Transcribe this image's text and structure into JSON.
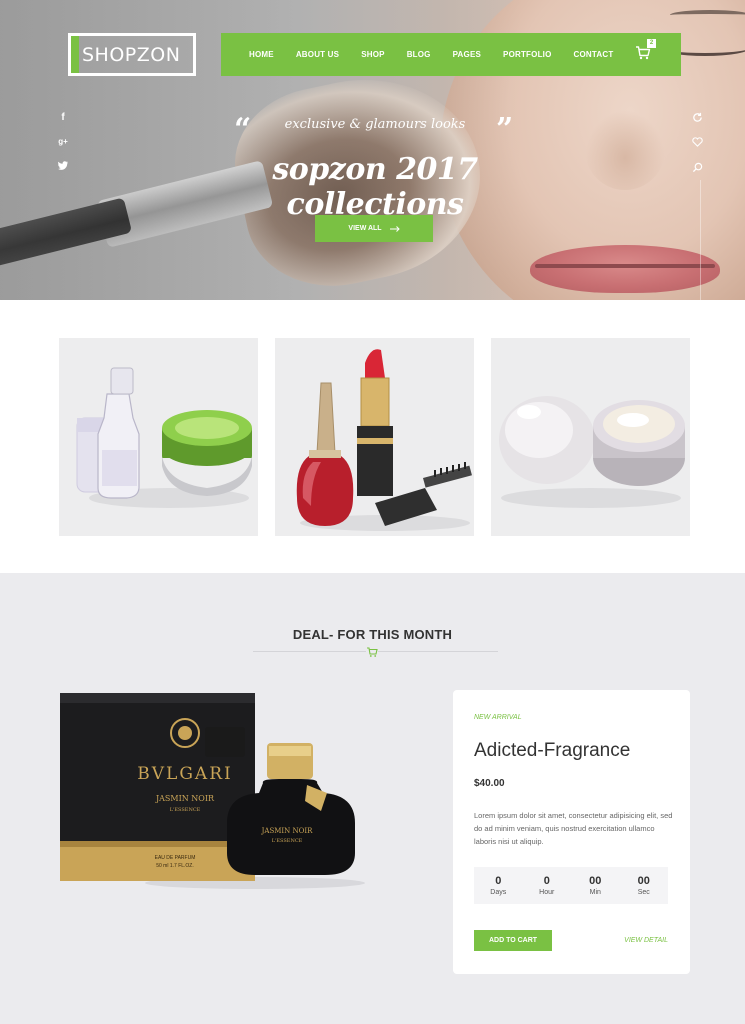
{
  "brand": {
    "logo_text": "SHOPZON"
  },
  "nav": {
    "items": [
      {
        "label": "HOME"
      },
      {
        "label": "ABOUT US"
      },
      {
        "label": "SHOP"
      },
      {
        "label": "BLOG"
      },
      {
        "label": "PAGES"
      },
      {
        "label": "PORTFOLIO"
      },
      {
        "label": "CONTACT"
      }
    ],
    "cart_count": "2"
  },
  "hero": {
    "tagline": "exclusive & glamours looks",
    "title": "sopzon 2017 collections",
    "button_label": "VIEW ALL"
  },
  "social": [
    "f",
    "g+",
    "twitter"
  ],
  "deal": {
    "title": "DEAL- FOR THIS MONTH",
    "badge": "NEW ARRIVAL",
    "product_name": "Adicted-Fragrance",
    "price": "$40.00",
    "description": "Lorem ipsum dolor sit amet, consectetur adipisicing elit, sed do ad minim veniam, quis nostrud exercitation ullamco laboris nisi ut aliquip.",
    "countdown": [
      {
        "value": "0",
        "label": "Days"
      },
      {
        "value": "0",
        "label": "Hour"
      },
      {
        "value": "00",
        "label": "Min"
      },
      {
        "value": "00",
        "label": "Sec"
      }
    ],
    "add_to_cart_label": "ADD TO CART",
    "view_detail_label": "VIEW DETAIL"
  },
  "packaging": {
    "brand_text": "BVLGARI",
    "box_subtitle": "JASMIN NOIR",
    "box_subtitle2": "L'ESSENCE",
    "bottle_text": "JASMIN NOIR",
    "bottle_text2": "L'ESSENCE",
    "box_small": "EAU DE PARFUM",
    "box_size": "50 ml  1.7 FL.OZ."
  },
  "colors": {
    "accent": "#7ac143",
    "deal_bg": "#ebebee",
    "tile_bg": "#ededee"
  }
}
